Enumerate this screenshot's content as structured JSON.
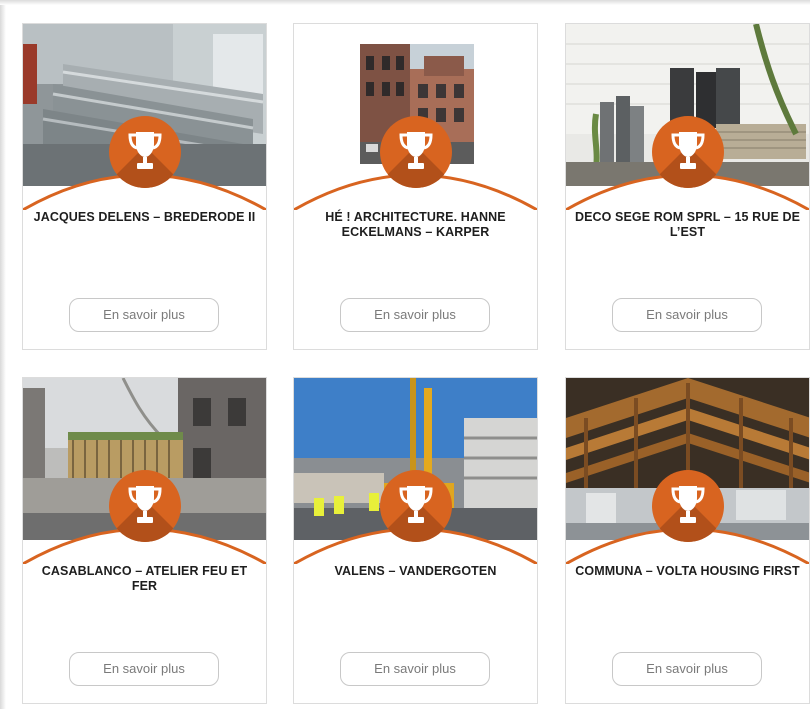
{
  "colors": {
    "accent": "#d86420",
    "accent_dark": "#b2501a"
  },
  "cards": [
    {
      "title": "JACQUES DELENS – BREDERODE II",
      "button": "En savoir plus",
      "icon": "trophy-icon"
    },
    {
      "title": "HÉ ! ARCHITECTURE. HANNE ECKELMANS – KARPER",
      "button": "En savoir plus",
      "icon": "trophy-icon"
    },
    {
      "title": "DECO SEGE ROM SPRL – 15 RUE DE L’EST",
      "button": "En savoir plus",
      "icon": "trophy-icon"
    },
    {
      "title": "CASABLANCO – ATELIER FEU ET FER",
      "button": "En savoir plus",
      "icon": "trophy-icon"
    },
    {
      "title": "VALENS – VANDERGOTEN",
      "button": "En savoir plus",
      "icon": "trophy-icon"
    },
    {
      "title": "COMMUNA – VOLTA HOUSING FIRST",
      "button": "En savoir plus",
      "icon": "trophy-icon"
    }
  ]
}
